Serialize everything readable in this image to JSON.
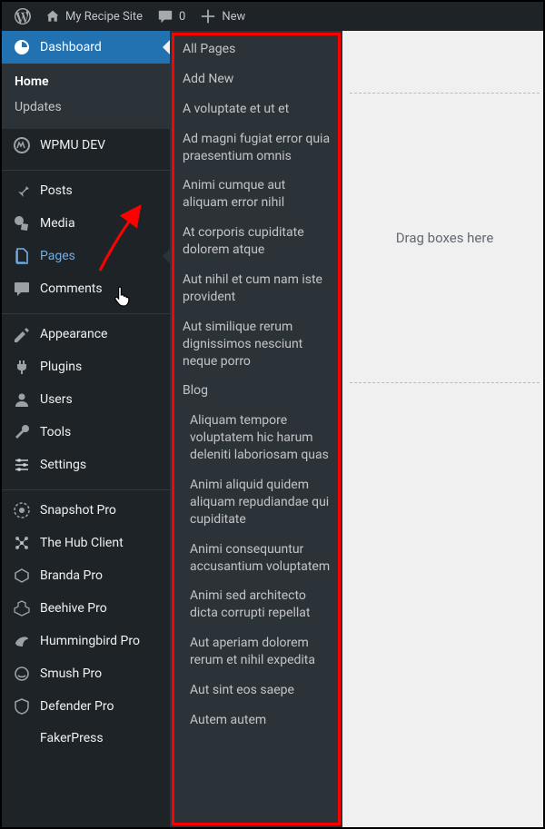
{
  "adminbar": {
    "site_name": "My Recipe Site",
    "comment_count": "0",
    "new_label": "New"
  },
  "sidebar": {
    "dashboard": "Dashboard",
    "sub_home": "Home",
    "sub_updates": "Updates",
    "wpmu": "WPMU DEV",
    "posts": "Posts",
    "media": "Media",
    "pages": "Pages",
    "comments": "Comments",
    "appearance": "Appearance",
    "plugins": "Plugins",
    "users": "Users",
    "tools": "Tools",
    "settings": "Settings",
    "snapshot": "Snapshot Pro",
    "hub": "The Hub Client",
    "branda": "Branda Pro",
    "beehive": "Beehive Pro",
    "hummingbird": "Hummingbird Pro",
    "smush": "Smush Pro",
    "defender": "Defender Pro",
    "fakerpress": "FakerPress"
  },
  "flyout": {
    "items": [
      {
        "label": "All Pages",
        "child": false
      },
      {
        "label": "Add New",
        "child": false
      },
      {
        "label": "A voluptate et ut et",
        "child": false
      },
      {
        "label": "Ad magni fugiat error quia praesentium omnis",
        "child": false
      },
      {
        "label": "Animi cumque aut aliquam error nihil",
        "child": false
      },
      {
        "label": "At corporis cupiditate dolorem atque",
        "child": false
      },
      {
        "label": "Aut nihil et cum nam iste provident",
        "child": false
      },
      {
        "label": "Aut similique rerum dignissimos nesciunt neque porro",
        "child": false
      },
      {
        "label": "Blog",
        "child": false
      },
      {
        "label": "Aliquam tempore voluptatem hic harum deleniti laboriosam quas",
        "child": true
      },
      {
        "label": "Animi aliquid quidem aliquam repudiandae qui cupiditate",
        "child": true
      },
      {
        "label": "Animi consequuntur accusantium voluptatem",
        "child": true
      },
      {
        "label": "Animi sed architecto dicta corrupti repellat",
        "child": true
      },
      {
        "label": "Aut aperiam dolorem rerum et nihil expedita",
        "child": true
      },
      {
        "label": "Aut sint eos saepe",
        "child": true
      },
      {
        "label": "Autem autem",
        "child": true
      }
    ]
  },
  "main": {
    "dropzone": "Drag boxes here"
  }
}
